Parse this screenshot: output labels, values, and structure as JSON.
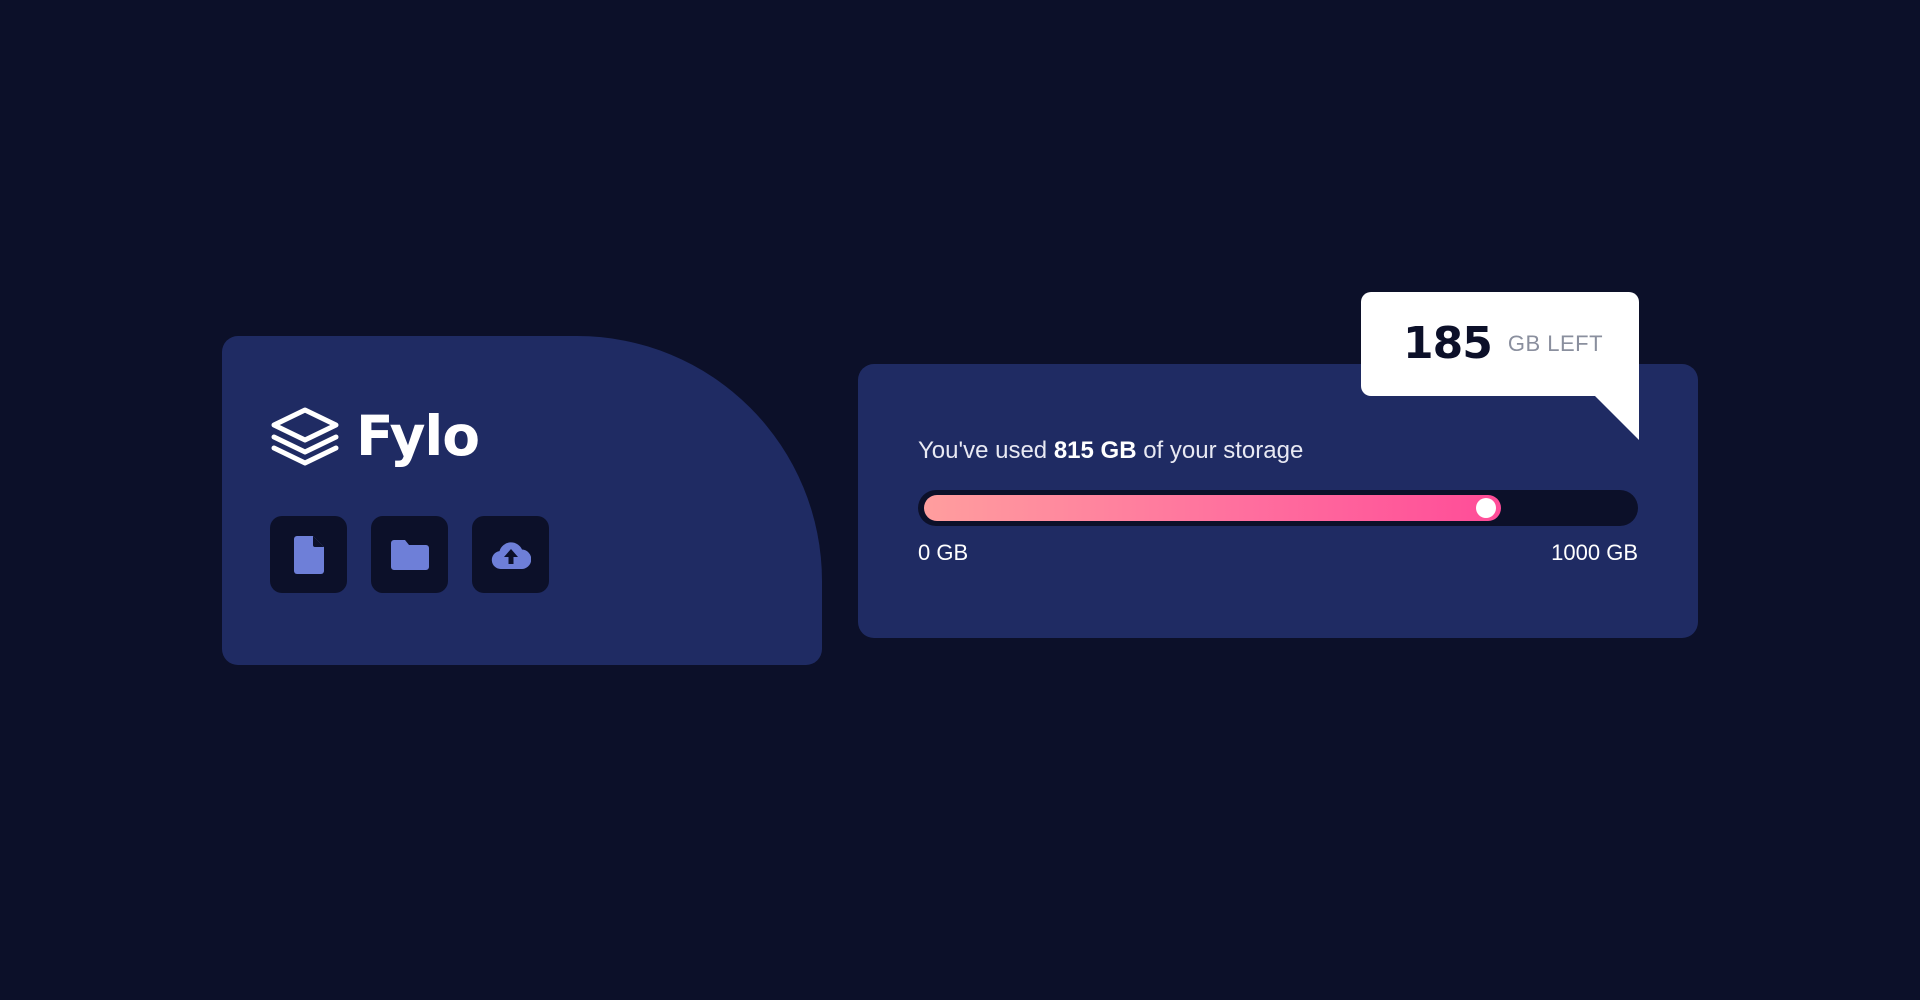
{
  "brand": {
    "name": "Fylo",
    "logo_icon": "stacked-layers-icon"
  },
  "actions": [
    {
      "icon": "document-icon"
    },
    {
      "icon": "folder-icon"
    },
    {
      "icon": "cloud-upload-icon"
    }
  ],
  "storage": {
    "used_prefix": "You've used",
    "used_value": "815 GB",
    "used_suffix": "of your storage",
    "min_label": "0 GB",
    "max_label": "1000 GB",
    "used_fraction": 0.815
  },
  "callout": {
    "remaining": "185",
    "unit": "GB LEFT"
  },
  "colors": {
    "background": "#0c1029",
    "card": "#1f2b63",
    "icon_accent": "#6e7fd8",
    "gradient_start": "#ff9e9e",
    "gradient_end": "#ff4c98"
  }
}
